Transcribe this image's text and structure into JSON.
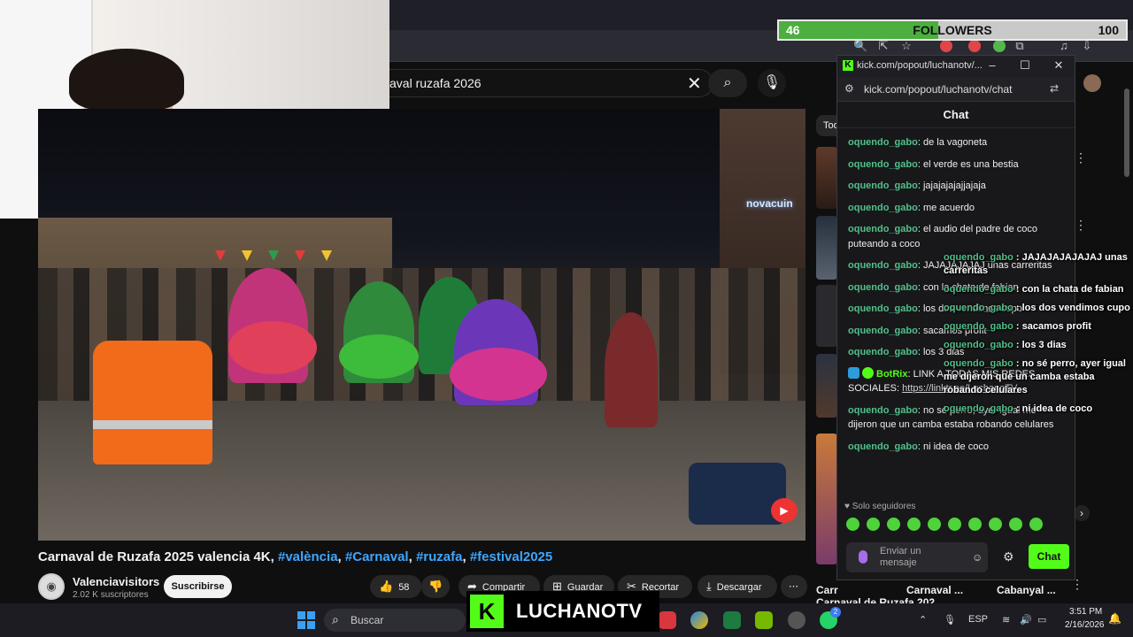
{
  "followers_goal": {
    "current": "46",
    "label": "FOLLOWERS",
    "target": "100",
    "progress": 0.46
  },
  "youtube": {
    "search": {
      "value": "aval ruzafa 2026"
    },
    "video": {
      "title_main": "Carnaval de Ruzafa 2025 valencia 4K,",
      "hashtags": [
        "#valència",
        "#Carnaval",
        "#ruzafa",
        "#festival2025"
      ],
      "channel_name": "Valenciavisitors",
      "channel_subs": "2.02 K suscriptores",
      "subscribe_label": "Suscribirse",
      "like_count": "58",
      "actions": {
        "share": "Compartir",
        "save": "Guardar",
        "clip": "Recortar",
        "download": "Descargar"
      },
      "store_sign": "novacuin"
    },
    "filter_chip": "Tod",
    "rail_titles": [
      "Carr",
      "Carnaval de Ruzafa 202...",
      "Carnaval ...",
      "Cabanyal ..."
    ]
  },
  "kick_popup": {
    "tab_title": "kick.com/popout/luchanotv/...",
    "url": "kick.com/popout/luchanotv/chat",
    "chat_header": "Chat",
    "messages": [
      {
        "user": "oquendo_gabo",
        "text": "de la vagoneta"
      },
      {
        "user": "oquendo_gabo",
        "text": "el verde es una bestia"
      },
      {
        "user": "oquendo_gabo",
        "text": "jajajajajajjajaja"
      },
      {
        "user": "oquendo_gabo",
        "text": "me acuerdo"
      },
      {
        "user": "oquendo_gabo",
        "text": "el audio del padre de coco puteando a coco"
      },
      {
        "user": "oquendo_gabo",
        "text": "JAJAJAJAJAJ unas carreritas"
      },
      {
        "user": "oquendo_gabo",
        "text": "con la chata de fabian"
      },
      {
        "user": "oquendo_gabo",
        "text": "los dos vendimos cupo"
      },
      {
        "user": "oquendo_gabo",
        "text": "sacamos profit"
      },
      {
        "user": "oquendo_gabo",
        "text": "los 3 dias"
      }
    ],
    "bot_message": {
      "user": "BotRix",
      "text": "LINK A TODAS MIS REDES SOCIALES:",
      "link": "https://linktr.ee/LuchanoTV"
    },
    "messages_after": [
      {
        "user": "oquendo_gabo",
        "text": "no sé perro, ayer igual me dijeron que un camba estaba robando celulares"
      },
      {
        "user": "oquendo_gabo",
        "text": "ni idea de coco"
      }
    ],
    "followers_only": "Solo seguidores",
    "input_placeholder": "Enviar un mensaje",
    "send_label": "Chat"
  },
  "overlay_chat": [
    {
      "user": "oquendo_gabo",
      "text": ": JAJAJAJAJAJAJ unas carreritas"
    },
    {
      "user": "oquendo_gabo",
      "text": ": con la chata de fabian"
    },
    {
      "user": "oquendo_gabo",
      "text": ": los dos vendimos cupo"
    },
    {
      "user": "oquendo_gabo",
      "text": ": sacamos profit"
    },
    {
      "user": "oquendo_gabo",
      "text": ": los 3 dias"
    },
    {
      "user": "oquendo_gabo",
      "text": ": no sé perro, ayer igual me dijeron que un camba estaba robando celulares"
    },
    {
      "user": "oquendo_gabo",
      "text": ": ni idea de coco"
    }
  ],
  "streamer_logo": "LUCHANOTV",
  "taskbar": {
    "search_placeholder": "Buscar",
    "language": "ESP",
    "time": "3:51 PM",
    "date": "2/16/2026",
    "whatsapp_badge": "2"
  },
  "colors": {
    "kick_green": "#53fc18",
    "yt_link_blue": "#3ea6ff",
    "chat_user_green": "#52c08a",
    "followers_fill": "#4caf3f"
  }
}
